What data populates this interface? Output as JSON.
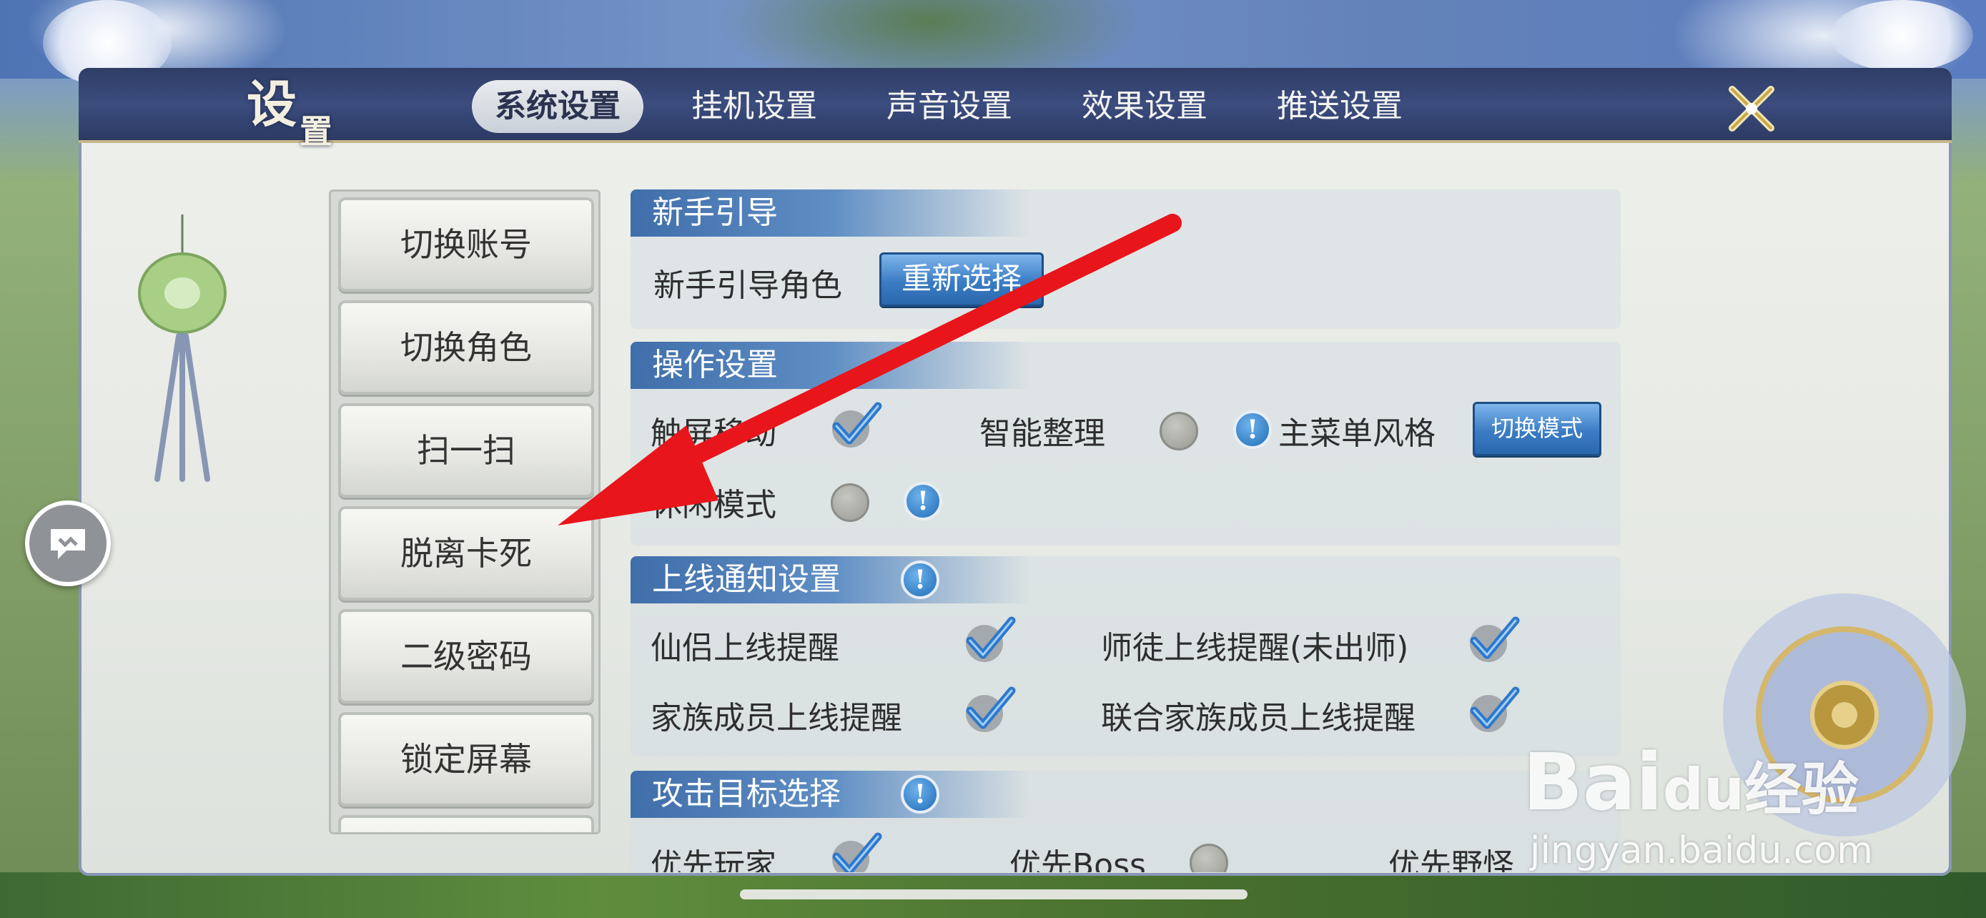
{
  "header": {
    "title_main": "设",
    "title_sub": "置",
    "tabs": [
      {
        "label": "系统设置",
        "active": true
      },
      {
        "label": "挂机设置",
        "active": false
      },
      {
        "label": "声音设置",
        "active": false
      },
      {
        "label": "效果设置",
        "active": false
      },
      {
        "label": "推送设置",
        "active": false
      }
    ],
    "close_icon": "close-x-icon"
  },
  "left_menu": {
    "items": [
      "切换账号",
      "切换角色",
      "扫一扫",
      "脱离卡死",
      "二级密码",
      "锁定屏幕"
    ]
  },
  "sections": {
    "guide": {
      "title": "新手引导",
      "role_label": "新手引导角色",
      "reselect_button": "重新选择"
    },
    "operation": {
      "title": "操作设置",
      "touch_move": {
        "label": "触屏移动",
        "checked": true
      },
      "smart_sort": {
        "label": "智能整理",
        "checked": false
      },
      "main_menu_style": {
        "label": "主菜单风格",
        "button": "切换模式"
      },
      "leisure_mode": {
        "label": "休闲模式",
        "checked": false
      }
    },
    "online_notify": {
      "title": "上线通知设置",
      "partner": {
        "label": "仙侣上线提醒",
        "checked": true
      },
      "master_apprentice": {
        "label": "师徒上线提醒(未出师)",
        "checked": true
      },
      "family_member": {
        "label": "家族成员上线提醒",
        "checked": true
      },
      "allied_family": {
        "label": "联合家族成员上线提醒",
        "checked": true
      }
    },
    "attack_target": {
      "title": "攻击目标选择",
      "prefer_player": {
        "label": "优先玩家",
        "checked": true
      },
      "prefer_boss": {
        "label": "优先Boss",
        "checked": false
      },
      "prefer_monster": {
        "label": "优先野怪"
      }
    }
  },
  "info_glyph": "!",
  "watermark": {
    "logo_text": "Bai",
    "logo_paw": "du",
    "logo_cn": "经验",
    "url": "jingyan.baidu.com"
  },
  "colors": {
    "header_bg": "#34446f",
    "section_head": "#3f6eaa",
    "check_blue": "#2f78c9",
    "arrow_red": "#e8151b"
  }
}
